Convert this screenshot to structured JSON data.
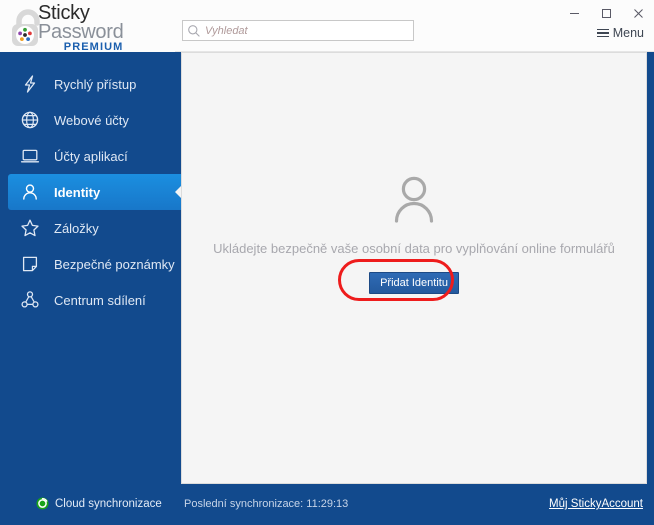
{
  "window": {
    "minimize_label": "Minimalizovat",
    "maximize_label": "Maximalizovat",
    "close_label": "Zavřít"
  },
  "brand": {
    "line1": "Sticky",
    "line2": "Password",
    "edition": "PREMIUM"
  },
  "topbar": {
    "menu_label": "Menu"
  },
  "search": {
    "placeholder": "Vyhledat",
    "value": ""
  },
  "sidebar": {
    "items": [
      {
        "label": "Rychlý přístup",
        "icon": "bolt-icon",
        "active": false
      },
      {
        "label": "Webové účty",
        "icon": "globe-icon",
        "active": false
      },
      {
        "label": "Účty aplikací",
        "icon": "monitor-icon",
        "active": false
      },
      {
        "label": "Identity",
        "icon": "person-icon",
        "active": true
      },
      {
        "label": "Záložky",
        "icon": "star-icon",
        "active": false
      },
      {
        "label": "Bezpečné poznámky",
        "icon": "note-icon",
        "active": false
      },
      {
        "label": "Centrum sdílení",
        "icon": "share-icon",
        "active": false
      }
    ]
  },
  "main": {
    "empty_icon": "person-avatar-icon",
    "empty_message": "Ukládejte bezpečně vaše osobní data pro vyplňování online formulářů",
    "add_button_label": "Přidat Identitu",
    "annotation": "red-highlight-ring"
  },
  "footer": {
    "sync_label": "Cloud synchronizace",
    "sync_icon": "cloud-sync-icon",
    "last_sync": "Poslední synchronizace: 11:29:13",
    "account_link": "Můj StickyAccount"
  },
  "colors": {
    "sidebar_blue": "#124a8d",
    "active_blue": "#1b8fe0",
    "button_blue": "#2f6bb5",
    "annotation_red": "#ee1c1c",
    "sync_green": "#19a319",
    "premium_blue": "#1b5fae"
  }
}
